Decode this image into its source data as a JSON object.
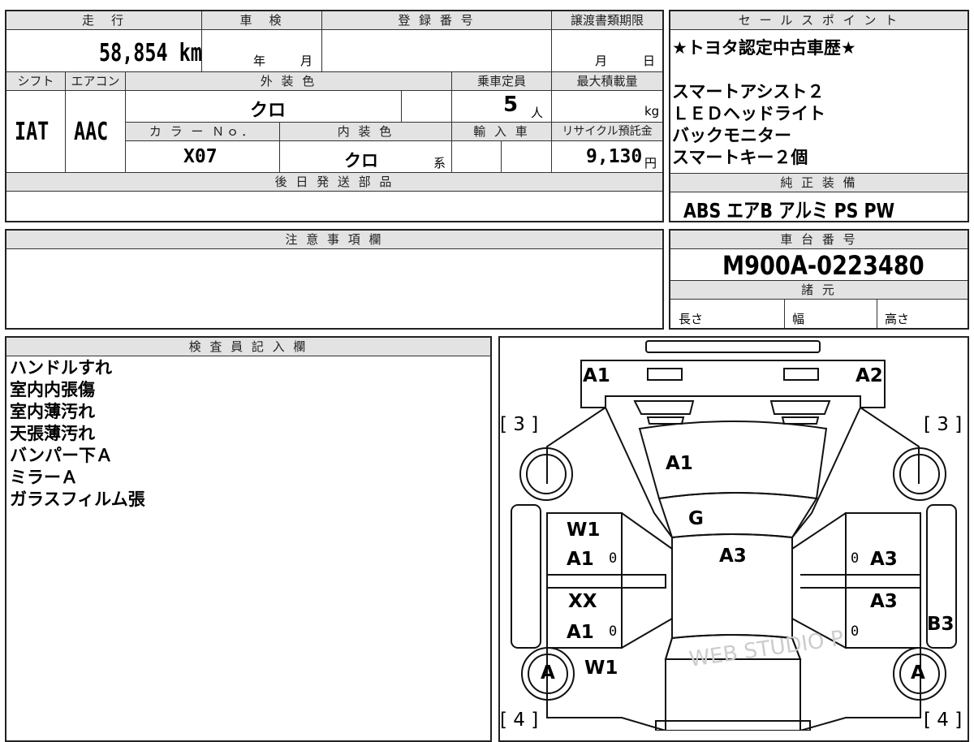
{
  "mileage": {
    "header": "走　行",
    "value": "58,854 km"
  },
  "shaken": {
    "header": "車　検",
    "year_unit": "年",
    "month_unit": "月"
  },
  "registration": {
    "header": "登 録 番 号",
    "value": ""
  },
  "transfer_deadline": {
    "header": "譲渡書類期限",
    "month_unit": "月",
    "day_unit": "日"
  },
  "shift": {
    "header": "シフト",
    "value": "IAT"
  },
  "aircon": {
    "header": "エアコン",
    "value": "AAC"
  },
  "exterior_color": {
    "header": "外 装 色",
    "value": "クロ"
  },
  "capacity": {
    "header": "乗車定員",
    "value": "5",
    "unit": "人"
  },
  "max_load": {
    "header": "最大積載量",
    "unit": "kg"
  },
  "color_no": {
    "header": "カ ラ ー Ｎｏ．",
    "value": "X07"
  },
  "interior_color": {
    "header": "内 装 色",
    "value": "クロ",
    "suffix": "系"
  },
  "import": {
    "header": "輸 入 車"
  },
  "recycle": {
    "header": "リサイクル預託金",
    "value": "9,130",
    "unit": "円"
  },
  "shipping_parts": {
    "header": "後 日 発 送 部 品"
  },
  "sales_point": {
    "header": "セ ー ル ス ポ イ ン ト",
    "lines": [
      "★トヨタ認定中古車歴★",
      "",
      "スマートアシスト２",
      "ＬＥＤヘッドライト",
      "バックモニター",
      "スマートキー２個"
    ]
  },
  "equipment": {
    "header": "純 正 装 備",
    "value": "ABS エアB アルミ PS PW"
  },
  "notes": {
    "header": "注 意 事 項 欄"
  },
  "chassis": {
    "header": "車 台 番 号",
    "value": "M900A-0223480"
  },
  "specs": {
    "header": "諸 元",
    "length": "長さ",
    "width": "幅",
    "height": "高さ"
  },
  "inspector": {
    "header": "検 査 員 記 入 欄",
    "lines": [
      "ハンドルすれ",
      "室内内張傷",
      "室内薄汚れ",
      "天張薄汚れ",
      "バンパー下Ａ",
      "ミラーＡ",
      "ガラスフィルム張"
    ]
  },
  "diagram": {
    "labels": {
      "front_left": "A1",
      "front_right": "A2",
      "hood": "A1",
      "windshield": "G",
      "roof": "A3",
      "left_front_door_1": "W1",
      "left_front_door_2": "A1",
      "left_rear_door_1": "XX",
      "left_rear_door_2": "A1",
      "left_quarter": "W1",
      "right_front_door": "A3",
      "right_rear_door": "A3",
      "right_rear_fender": "B3",
      "left_rear_wheel": "A",
      "right_rear_wheel": "A",
      "bracket_tl": "[ 3 ]",
      "bracket_tr": "[ 3 ]",
      "bracket_bl": "[ 4 ]",
      "bracket_br": "[ 4 ]"
    },
    "zeros": [
      "0",
      "0",
      "0",
      "0"
    ],
    "watermark": "WEB STUDIO P"
  }
}
